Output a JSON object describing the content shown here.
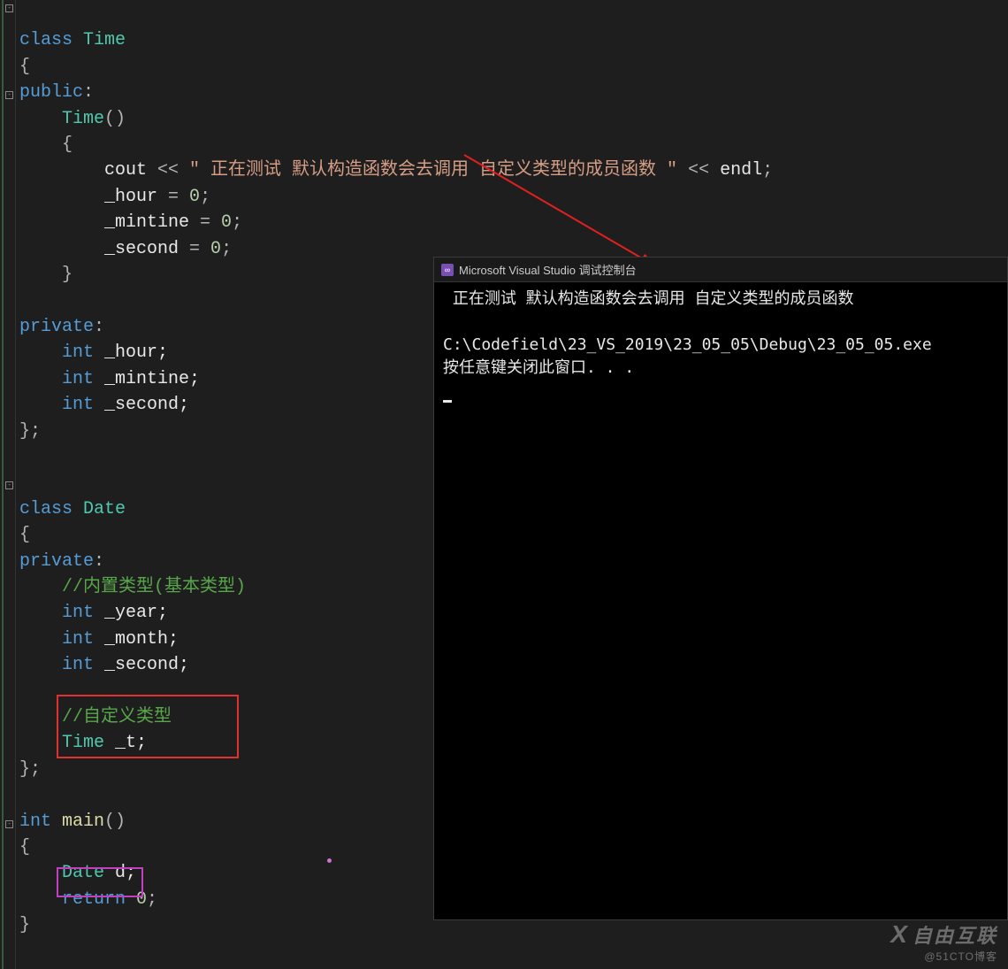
{
  "code": {
    "l1": "class",
    "l1b": "Time",
    "l2": "{",
    "l3a": "public",
    "l3b": ":",
    "l4a": "Time",
    "l4b": "()",
    "l5": "{",
    "l6a": "cout ",
    "l6b": "<< ",
    "l6c": "\" 正在测试 默认构造函数会去调用 自定义类型的成员函数 \"",
    "l6d": " << ",
    "l6e": "endl",
    "l6f": ";",
    "l7a": "_hour",
    "l7b": " = ",
    "l7c": "0",
    "l7d": ";",
    "l8a": "_mintine",
    "l8b": " = ",
    "l8c": "0",
    "l8d": ";",
    "l9a": "_second",
    "l9b": " = ",
    "l9c": "0",
    "l9d": ";",
    "l10": "}",
    "l11": "",
    "l12a": "private",
    "l12b": ":",
    "l13a": "int",
    "l13b": " _hour;",
    "l14a": "int",
    "l14b": " _mintine;",
    "l15a": "int",
    "l15b": " _second;",
    "l16": "};",
    "l17": "",
    "l18": "",
    "l19a": "class",
    "l19b": "Date",
    "l20": "{",
    "l21a": "private",
    "l21b": ":",
    "l22": "//内置类型(基本类型)",
    "l23a": "int",
    "l23b": " _year;",
    "l24a": "int",
    "l24b": " _month;",
    "l25a": "int",
    "l25b": " _second;",
    "l26": "",
    "l27": "//自定义类型",
    "l28a": "Time",
    "l28b": " _t;",
    "l29": "};",
    "l30": "",
    "l31a": "int",
    "l31b": " main",
    "l31c": "()",
    "l32": "{",
    "l33a": "Date",
    "l33b": " d;",
    "l34a": "return",
    "l34b": " 0",
    "l34c": ";",
    "l35": "}"
  },
  "console": {
    "title": "Microsoft Visual Studio 调试控制台",
    "line1": " 正在测试 默认构造函数会去调用 自定义类型的成员函数",
    "line2": "",
    "line3": "C:\\Codefield\\23_VS_2019\\23_05_05\\Debug\\23_05_05.exe",
    "line4": "按任意键关闭此窗口. . ."
  },
  "watermark": {
    "main": "自由互联",
    "sub": "@51CTO博客"
  }
}
